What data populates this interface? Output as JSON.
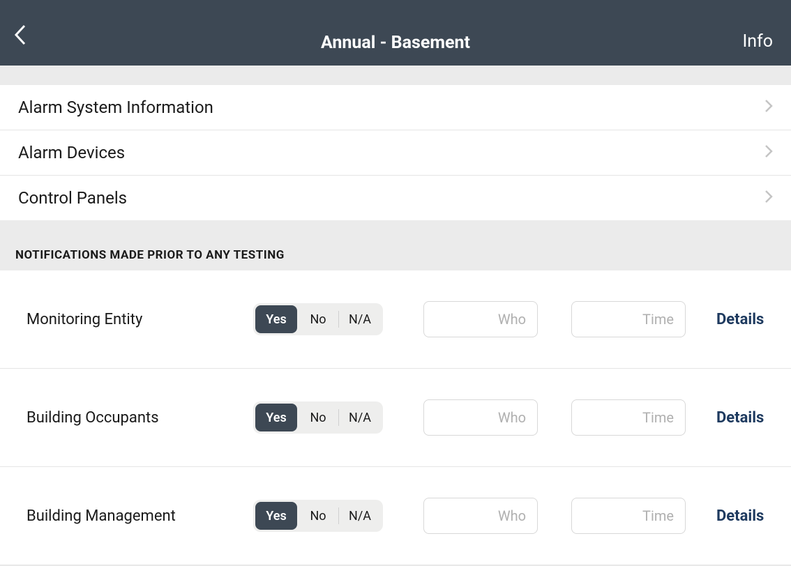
{
  "header": {
    "title": "Annual - Basement",
    "info_label": "Info"
  },
  "nav_items": [
    {
      "label": "Alarm System Information"
    },
    {
      "label": "Alarm Devices"
    },
    {
      "label": "Control Panels"
    }
  ],
  "section_title": "NOTIFICATIONS MADE PRIOR TO ANY TESTING",
  "segment_options": {
    "yes": "Yes",
    "no": "No",
    "na": "N/A"
  },
  "placeholders": {
    "who": "Who",
    "time": "Time"
  },
  "details_label": "Details",
  "notifications": [
    {
      "label": "Monitoring Entity",
      "selected": "yes",
      "who": "",
      "time": ""
    },
    {
      "label": "Building Occupants",
      "selected": "yes",
      "who": "",
      "time": ""
    },
    {
      "label": "Building Management",
      "selected": "yes",
      "who": "",
      "time": ""
    }
  ]
}
